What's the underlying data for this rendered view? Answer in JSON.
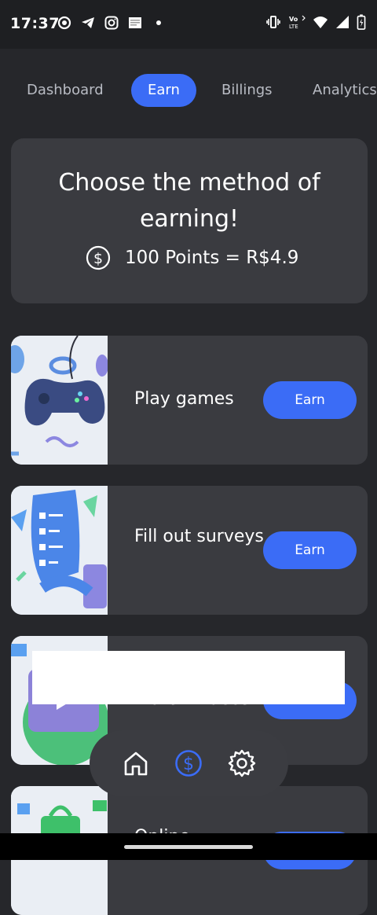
{
  "status_bar": {
    "time": "17:37",
    "left_icons": [
      "screen-record-icon",
      "telegram-icon",
      "instagram-icon",
      "notification-icon",
      "dot-icon"
    ],
    "right_icons": [
      "vibrate-icon",
      "volte-icon",
      "wifi-icon",
      "signal-icon",
      "battery-icon"
    ],
    "volte_label": "Vo LTE"
  },
  "tabs": [
    {
      "label": "Dashboard",
      "active": false
    },
    {
      "label": "Earn",
      "active": true
    },
    {
      "label": "Billings",
      "active": false
    },
    {
      "label": "Analytics",
      "active": false
    }
  ],
  "hero": {
    "title": "Choose the method of earning!",
    "rate": "100 Points = R$4.9",
    "coin_icon": "dollar-coin-icon"
  },
  "methods": [
    {
      "label": "Play games",
      "button": "Earn",
      "thumb": "gamepad-illustration"
    },
    {
      "label": "Fill out surveys",
      "button": "Earn",
      "thumb": "survey-illustration"
    },
    {
      "label": "Watch videos",
      "button": "Earn",
      "thumb": "video-illustration"
    },
    {
      "label": "Online",
      "button": "Earn",
      "thumb": "shopping-illustration"
    }
  ],
  "bottom_nav": [
    {
      "icon": "home-icon",
      "active": false
    },
    {
      "icon": "dollar-icon",
      "active": true
    },
    {
      "icon": "gear-icon",
      "active": false
    }
  ],
  "colors": {
    "background": "#26272b",
    "card": "#3a3b40",
    "accent": "#3b6cf6",
    "text": "#ffffff",
    "muted": "#b9bcc4"
  }
}
